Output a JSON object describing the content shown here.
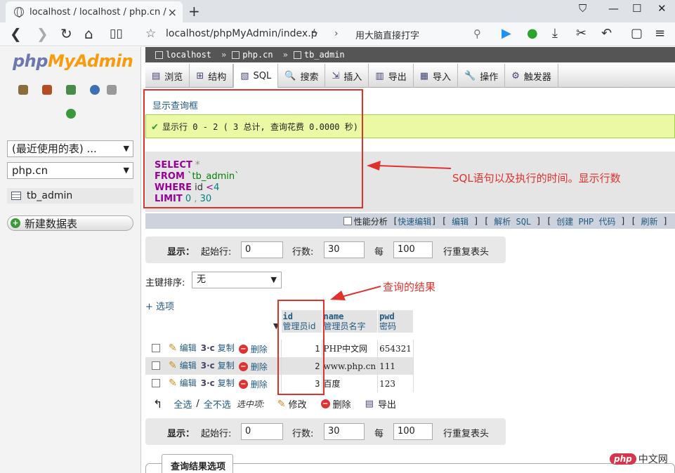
{
  "browser": {
    "tab_title": "localhost / localhost / php.cn / tb_admin",
    "url": "localhost/phpMyAdmin/index.p",
    "search_text": "用大脑直接打字",
    "controls": {
      "minimize": "—",
      "maximize": "☐",
      "close": "✕",
      "tshirt": "👕"
    }
  },
  "sidebar": {
    "logo_php": "php",
    "logo_my": "MyAdmin",
    "recent_tables": "(最近使用的表) ...",
    "database": "php.cn",
    "table_item": "tb_admin",
    "new_table": "新建数据表"
  },
  "breadcrumb": [
    "localhost",
    "php.cn",
    "tb_admin"
  ],
  "tabs": [
    {
      "label": "浏览",
      "icon": "browse-icon"
    },
    {
      "label": "结构",
      "icon": "structure-icon"
    },
    {
      "label": "SQL",
      "icon": "sql-icon"
    },
    {
      "label": "搜索",
      "icon": "search-icon"
    },
    {
      "label": "插入",
      "icon": "insert-icon"
    },
    {
      "label": "导出",
      "icon": "export-icon"
    },
    {
      "label": "导入",
      "icon": "import-icon"
    },
    {
      "label": "操作",
      "icon": "wrench-icon"
    },
    {
      "label": "触发器",
      "icon": "trigger-icon"
    }
  ],
  "show_query_box": "显示查询框",
  "success_message": "显示行 0 - 2 ( 3 总计, 查询花费 0.0000 秒)",
  "sql": {
    "select": "SELECT",
    "star": "*",
    "from": "FROM",
    "table": "`tb_admin`",
    "where": "WHERE",
    "col": "id",
    "op": "<",
    "val": "4",
    "limit": "LIMIT",
    "offset": "0",
    "comma": ",",
    "count": "30"
  },
  "sql_actions": {
    "profiling": "性能分析",
    "inline_edit": "快速编辑",
    "edit": "编辑",
    "explain": "解析 SQL",
    "php_code": "创建 PHP 代码",
    "refresh": "刷新"
  },
  "nav_form": {
    "show": "显示：",
    "start_row": "起始行:",
    "start_value": "0",
    "rows": "行数:",
    "rows_value": "30",
    "per": "每",
    "repeat_value": "100",
    "repeat_label": "行重复表头"
  },
  "sort": {
    "label": "主键排序:",
    "value": "无"
  },
  "options_link": "+ 选项",
  "table": {
    "columns": [
      {
        "name": "id",
        "comment": "管理员id"
      },
      {
        "name": "name",
        "comment": "管理员名字"
      },
      {
        "name": "pwd",
        "comment": "密码"
      }
    ],
    "row_actions": {
      "edit": "编辑",
      "copy": "复制",
      "delete": "删除"
    },
    "rows": [
      {
        "id": "1",
        "name": "PHP中文网",
        "pwd": "654321"
      },
      {
        "id": "2",
        "name": "www.php.cn",
        "pwd": "111"
      },
      {
        "id": "3",
        "name": "百度",
        "pwd": "123"
      }
    ]
  },
  "bulk": {
    "check_all": "全选",
    "slash": "/",
    "uncheck_all": "全不选",
    "with_selected": "选中项:",
    "change": "修改",
    "delete": "删除",
    "export": "导出"
  },
  "query_results_options": "查询结果选项",
  "annotations": {
    "sql_note": "SQL语句以及执行的时间。显示行数",
    "result_note": "查询的结果"
  },
  "watermark": {
    "php": "php",
    "cn": "中文网"
  },
  "colors": {
    "annotation": "#e0322d",
    "link": "#235a81",
    "success_bg": "#ebf8a4"
  }
}
